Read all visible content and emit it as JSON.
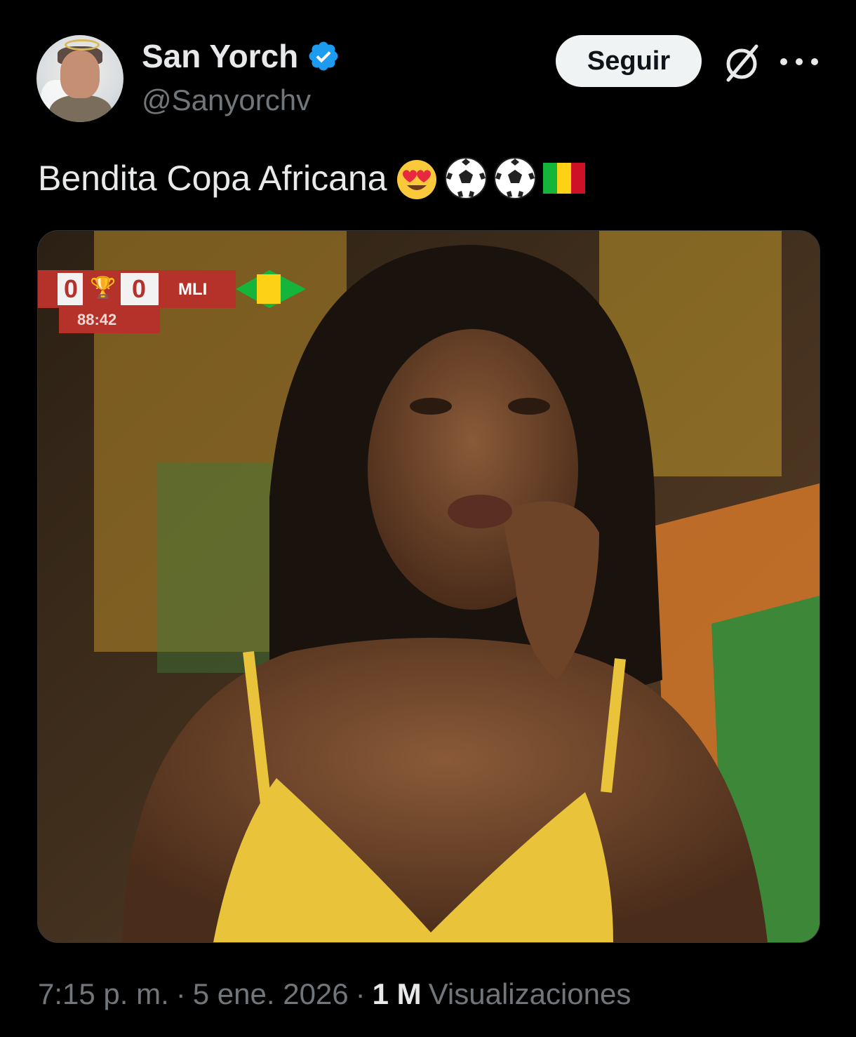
{
  "author": {
    "display_name": "San Yorch",
    "handle": "@Sanyorchv",
    "verified": true
  },
  "actions": {
    "follow_label": "Seguir"
  },
  "tweet": {
    "text": "Bendita Copa Africana",
    "emojis": [
      "smiling-face-with-heart-eyes",
      "soccer-ball",
      "soccer-ball",
      "mali-flag"
    ]
  },
  "media": {
    "scoreboard": {
      "home_score": "0",
      "away_score": "0",
      "team": "MLI",
      "clock": "88:42"
    }
  },
  "meta": {
    "time": "7:15 p. m.",
    "separator1": "·",
    "date": "5 ene. 2026",
    "separator2": "·",
    "views_count": "1 M",
    "views_label": "Visualizaciones"
  },
  "colors": {
    "background": "#000000",
    "text_primary": "#e7e9ea",
    "text_secondary": "#71767b",
    "verified_blue": "#1d9bf0",
    "follow_button_bg": "#eff3f4"
  }
}
